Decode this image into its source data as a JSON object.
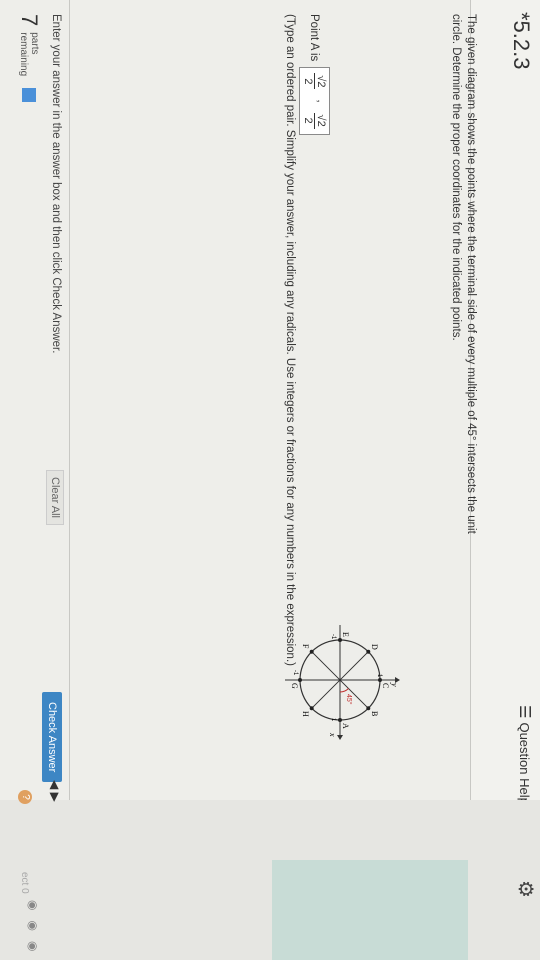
{
  "header": {
    "problem_number": "*5.2.3",
    "question_help": "Question Help"
  },
  "prompt": {
    "text": "The given diagram shows the points where the terminal side of every multiple of 45° intersects the unit circle. Determine the proper coordinates for the indicated points."
  },
  "answer": {
    "label": "Point A is",
    "x_num": "√2",
    "x_den": "2",
    "y_num": "√2",
    "y_den": "2",
    "hint": "(Type an ordered pair. Simplify your answer, including any radicals. Use integers or fractions for any numbers in the expression.)"
  },
  "diagram": {
    "labels": [
      "A",
      "B",
      "C",
      "D",
      "E",
      "F",
      "G",
      "H"
    ],
    "angle_label": "45°",
    "x_axis": "x",
    "y_axis": "y",
    "one_x": "1",
    "one_y": "1",
    "neg_one_x": "-1",
    "neg_one_y": "-1"
  },
  "footer": {
    "instruction": "Enter your answer in the answer box and then click Check Answer.",
    "parts_count": "7",
    "parts_label_1": "parts",
    "parts_label_2": "remaining",
    "clear_all": "Clear All",
    "check_answer": "Check Answer",
    "help_badge": "?",
    "edge_text": "ect 0"
  },
  "colors": {
    "accent": "#3d86c4",
    "progress": "#4a90d9",
    "teal_panel": "#c8dcd6"
  }
}
